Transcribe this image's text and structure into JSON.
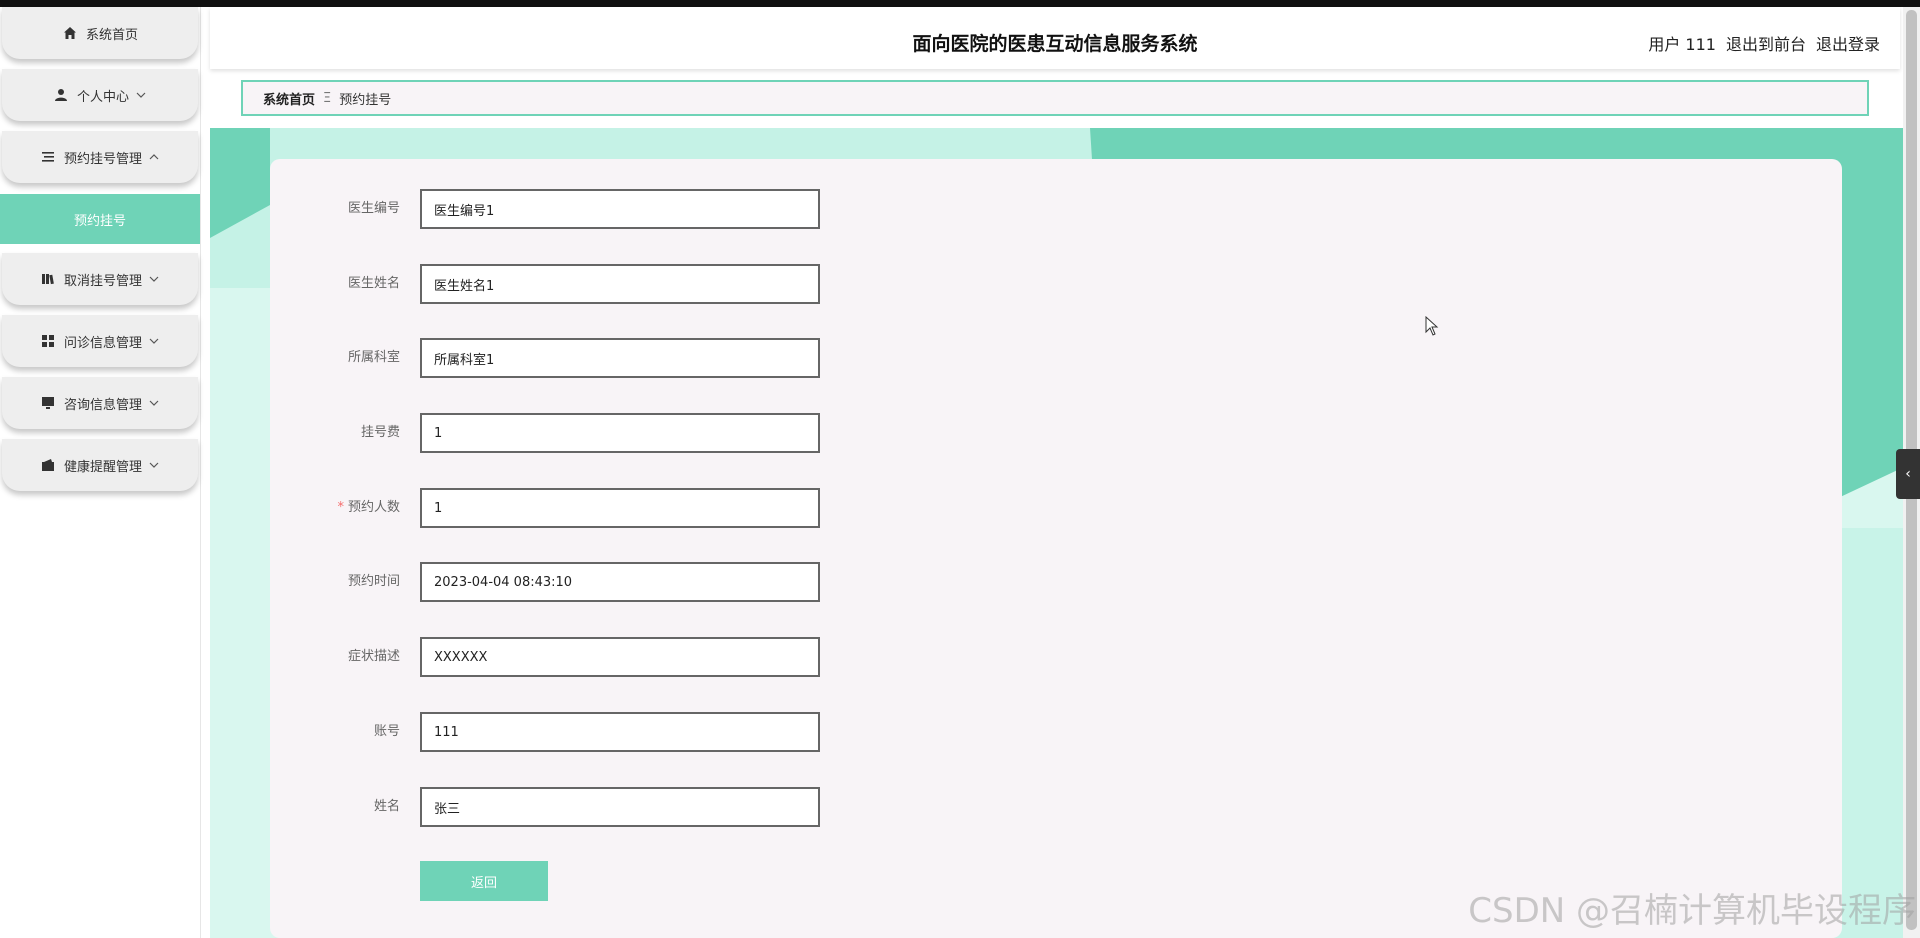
{
  "app": {
    "title": "面向医院的医患互动信息服务系统"
  },
  "header": {
    "user_label": "用户 111",
    "exit_front_label": "退出到前台",
    "logout_label": "退出登录"
  },
  "sidebar": {
    "items": [
      {
        "label": "系统首页",
        "icon": "home-icon"
      },
      {
        "label": "个人中心",
        "icon": "user-icon"
      },
      {
        "label": "预约挂号管理",
        "icon": "list-icon"
      },
      {
        "label": "取消挂号管理",
        "icon": "book-icon"
      },
      {
        "label": "问诊信息管理",
        "icon": "grid-icon"
      },
      {
        "label": "咨询信息管理",
        "icon": "monitor-icon"
      },
      {
        "label": "健康提醒管理",
        "icon": "wallet-icon"
      }
    ],
    "active_sub": {
      "label": "预约挂号"
    }
  },
  "breadcrumb": {
    "home": "系统首页",
    "separator": "Ξ",
    "current": "预约挂号"
  },
  "form": {
    "fields": [
      {
        "label": "医生编号",
        "value": "医生编号1",
        "required": false
      },
      {
        "label": "医生姓名",
        "value": "医生姓名1",
        "required": false
      },
      {
        "label": "所属科室",
        "value": "所属科室1",
        "required": false
      },
      {
        "label": "挂号费",
        "value": "1",
        "required": false
      },
      {
        "label": "预约人数",
        "value": "1",
        "required": true
      },
      {
        "label": "预约时间",
        "value": "2023-04-04 08:43:10",
        "required": false
      },
      {
        "label": "症状描述",
        "value": "XXXXXX",
        "required": false
      },
      {
        "label": "账号",
        "value": "111",
        "required": false
      },
      {
        "label": "姓名",
        "value": "张三",
        "required": false
      }
    ],
    "required_mark": "*",
    "back_button": "返回"
  },
  "side_tab": {
    "glyph": "‹"
  },
  "watermark": "CSDN @召楠计算机毕设程序",
  "colors": {
    "accent": "#6fd3b7",
    "card_bg": "#f8f4f7",
    "required": "#f56c6c"
  }
}
